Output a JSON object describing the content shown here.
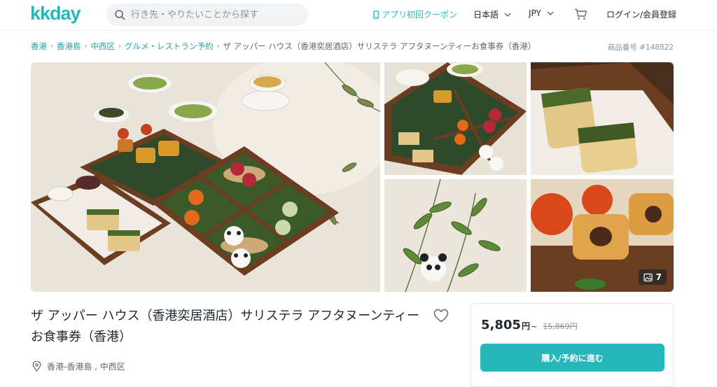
{
  "header": {
    "logo_text": "kkday",
    "search_placeholder": "行き先・やりたいことから探す",
    "coupon": "アプリ初回クーポン",
    "language": "日本語",
    "currency": "JPY",
    "login": "ログイン/会員登録",
    "brand_color": "#26b7bc"
  },
  "breadcrumb": {
    "items": [
      "香港",
      "香港島",
      "中西区",
      "グルメ・レストラン予約"
    ],
    "current": "ザ アッパー ハウス（香港奕居酒店）サリステラ アフタヌーンティーお食事券（香港）"
  },
  "product_no": "商品番号 #148822",
  "gallery": {
    "more_count": "7"
  },
  "product": {
    "title": "ザ アッパー ハウス（香港奕居酒店）サリステラ アフタヌーンティーお食事券（香港）",
    "location": "香港-香港島 , 中西区"
  },
  "booking": {
    "price": "5,805",
    "price_unit": "円",
    "price_suffix": "~",
    "original_price": "15,869円",
    "button": "購入/予約に進む"
  }
}
